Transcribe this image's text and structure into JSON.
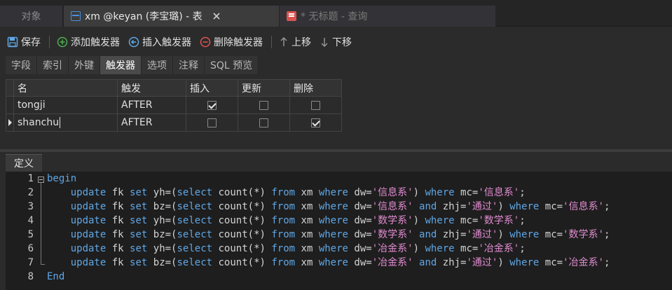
{
  "tabs": [
    {
      "label": "对象"
    },
    {
      "label": "xm @keyan (李宝璐) - 表"
    },
    {
      "label": "* 无标题 - 查询"
    }
  ],
  "toolbar": {
    "save": "保存",
    "add": "添加触发器",
    "insert": "插入触发器",
    "delete": "删除触发器",
    "up": "上移",
    "down": "下移"
  },
  "subtabs": [
    "字段",
    "索引",
    "外键",
    "触发器",
    "选项",
    "注释",
    "SQL 预览"
  ],
  "grid": {
    "headers": [
      "名",
      "触发",
      "插入",
      "更新",
      "删除"
    ],
    "rows": [
      {
        "name": "tongji",
        "fire": "AFTER",
        "insert": true,
        "update": false,
        "delete": false
      },
      {
        "name": "shanchu",
        "fire": "AFTER",
        "insert": false,
        "update": false,
        "delete": true
      }
    ]
  },
  "definition_tab": "定义",
  "code": {
    "line_numbers": [
      "1",
      "2",
      "3",
      "4",
      "5",
      "6",
      "7",
      "8"
    ],
    "lines": [
      "begin",
      "    update fk set yh=(select count(*) from xm where dw='信息系') where mc='信息系';",
      "    update fk set bz=(select count(*) from xm where dw='信息系' and zhj='通过') where mc='信息系';",
      "    update fk set yh=(select count(*) from xm where dw='数学系') where mc='数学系';",
      "    update fk set bz=(select count(*) from xm where dw='数学系' and zhj='通过') where mc='数学系';",
      "    update fk set yh=(select count(*) from xm where dw='冶金系') where mc='冶金系';",
      "    update fk set bz=(select count(*) from xm where dw='冶金系' and zhj='通过') where mc='冶金系';",
      "End"
    ]
  },
  "colors": {
    "keyword": "#5fa7e6",
    "string": "#e08cd0",
    "background": "#2b2b2b",
    "editor_bg": "#1e1e1e"
  }
}
